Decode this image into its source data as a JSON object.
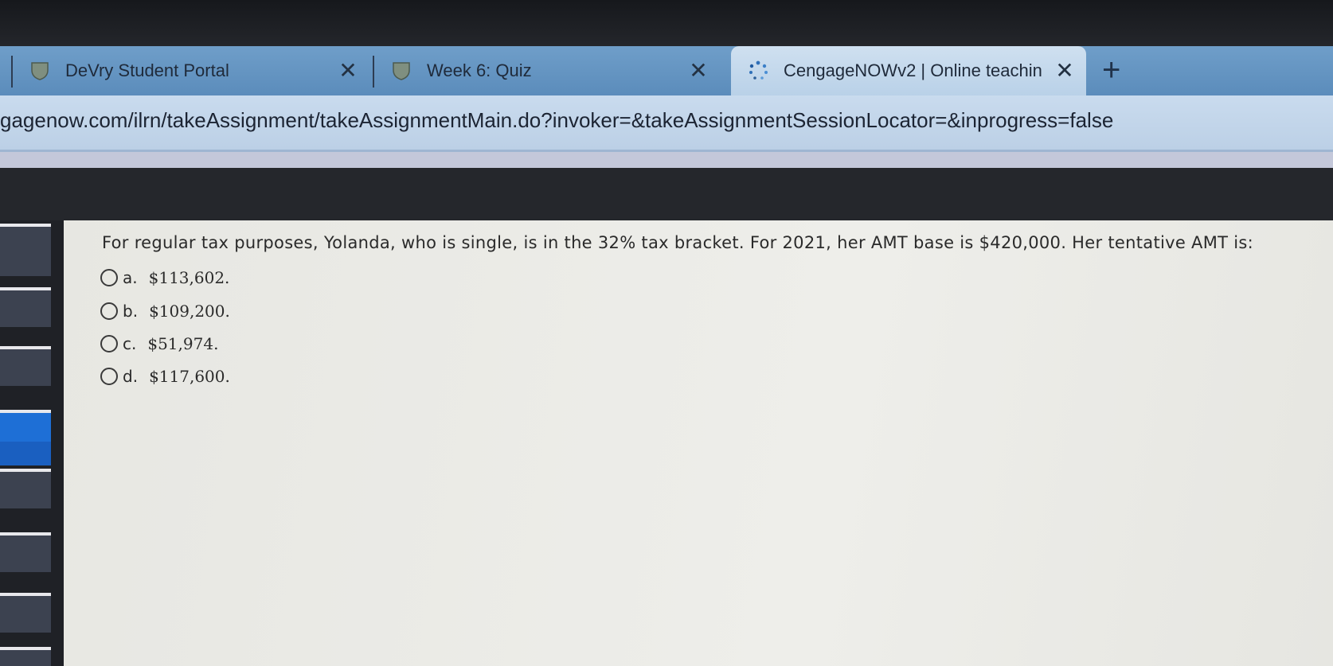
{
  "browser": {
    "tabs": [
      {
        "title": "DeVry Student Portal",
        "icon": "shield-icon",
        "active": false
      },
      {
        "title": "Week 6: Quiz",
        "icon": "shield-icon",
        "active": false
      },
      {
        "title": "CengageNOWv2 | Online teachin",
        "icon": "loading-spinner-icon",
        "active": true
      }
    ],
    "close_glyph": "✕",
    "new_tab_glyph": "+",
    "url": "gagenow.com/ilrn/takeAssignment/takeAssignmentMain.do?invoker=&takeAssignmentSessionLocator=&inprogress=false"
  },
  "quiz": {
    "question": "For regular tax purposes, Yolanda, who is single, is in the 32% tax bracket. For 2021, her AMT base is $420,000. Her tentative AMT is:",
    "options": [
      {
        "letter": "a.",
        "text": "$113,602."
      },
      {
        "letter": "b.",
        "text": "$109,200."
      },
      {
        "letter": "c.",
        "text": "$51,974."
      },
      {
        "letter": "d.",
        "text": "$117,600."
      }
    ]
  },
  "colors": {
    "tabstrip": "#6f9ec9",
    "active_tab": "#cfe0f0",
    "sidebar_accent": "#1e6fd6"
  }
}
